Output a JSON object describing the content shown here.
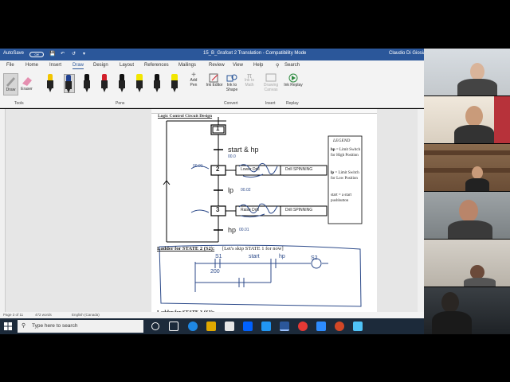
{
  "window": {
    "title": "15_B_Grafcet 2 Translation  -  Compatibility Mode",
    "user": "Claudio Di Giosia",
    "autosave_label": "AutoSave",
    "autosave_state": "Off"
  },
  "menu": [
    "File",
    "Home",
    "Insert",
    "Draw",
    "Design",
    "Layout",
    "References",
    "Mailings",
    "Review",
    "View",
    "Help"
  ],
  "search_label": "Search",
  "ribbon": {
    "tools": {
      "draw": "Draw",
      "eraser": "Eraser",
      "group": "Tools"
    },
    "pens_group": "Pens",
    "add_pen": "Add Pen",
    "convert": {
      "ink_editor": "Ink Editor",
      "ink_to_shape": "Ink to Shape",
      "ink_to_math": "Ink to Math",
      "group": "Convert"
    },
    "insert": {
      "drawing_canvas": "Drawing Canvas",
      "group": "Insert"
    },
    "replay": {
      "ink_replay": "Ink Replay",
      "group": "Replay"
    },
    "pen_colors": [
      "#f2c500",
      "#1f3f8f",
      "#111111",
      "#d21f2a",
      "#111111",
      "#f2e600",
      "#111111",
      "#f2e600"
    ]
  },
  "document": {
    "heading_top": "Logic Control Circuit Design",
    "steps": [
      "1",
      "2",
      "3"
    ],
    "transitions": [
      "start & hp",
      "lp",
      "hp"
    ],
    "ink_notes": [
      "00.0",
      "00.01",
      "00.02",
      "00.01"
    ],
    "actions": {
      "step2_left": "Lower Drill",
      "step2_right": "Drill SPINNING",
      "step3_left": "Raise Drill",
      "step3_right": "Drill SPINNING"
    },
    "legend": {
      "title": "LEGEND",
      "items": [
        {
          "key": "hp",
          "desc": " = Limit Switch for High Position"
        },
        {
          "key": "lp",
          "desc": " = Limit Switch for Low Position"
        },
        {
          "key": "start",
          "desc": " = a start pushbutton"
        }
      ]
    },
    "ladder_title": "Ladder for STATE 2 (S2):",
    "ladder_note": "[Let's skip STATE 1 for now]",
    "ladder_ink": [
      "S1",
      "start",
      "hp",
      "S2",
      "200"
    ],
    "ladder_next": "Ladder for STATE 3 (S3):"
  },
  "status": {
    "page": "Page 3 of 11",
    "words": "472 words",
    "lang": "English (Canada)"
  },
  "taskbar": {
    "search_placeholder": "Type here to search"
  }
}
